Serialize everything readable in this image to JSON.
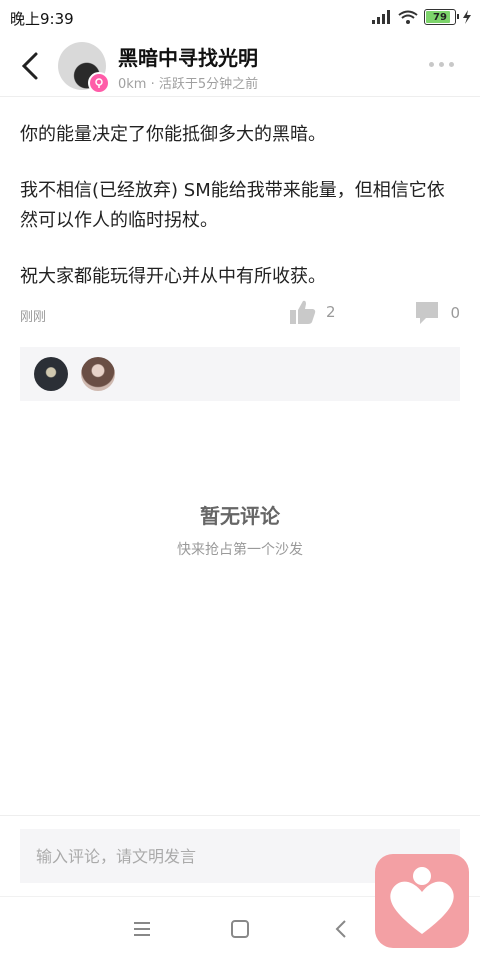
{
  "status_bar": {
    "time": "晚上9:39",
    "battery": "79"
  },
  "header": {
    "title": "黑暗中寻找光明",
    "subtitle": "0km · 活跃于5分钟之前"
  },
  "post": {
    "paragraphs": [
      "你的能量决定了你能抵御多大的黑暗。",
      "我不相信(已经放弃) SM能给我带来能量，但相信它依然可以作人的临时拐杖。",
      "祝大家都能玩得开心并从中有所收获。"
    ],
    "time": "刚刚",
    "likes": "2",
    "comments": "0"
  },
  "empty_state": {
    "title": "暂无评论",
    "subtitle": "快来抢占第一个沙发"
  },
  "comment_input": {
    "placeholder": "输入评论，请文明发言"
  },
  "colors": {
    "accent_pink": "#ff5ca8",
    "floating_button": "#f3a0a4"
  }
}
